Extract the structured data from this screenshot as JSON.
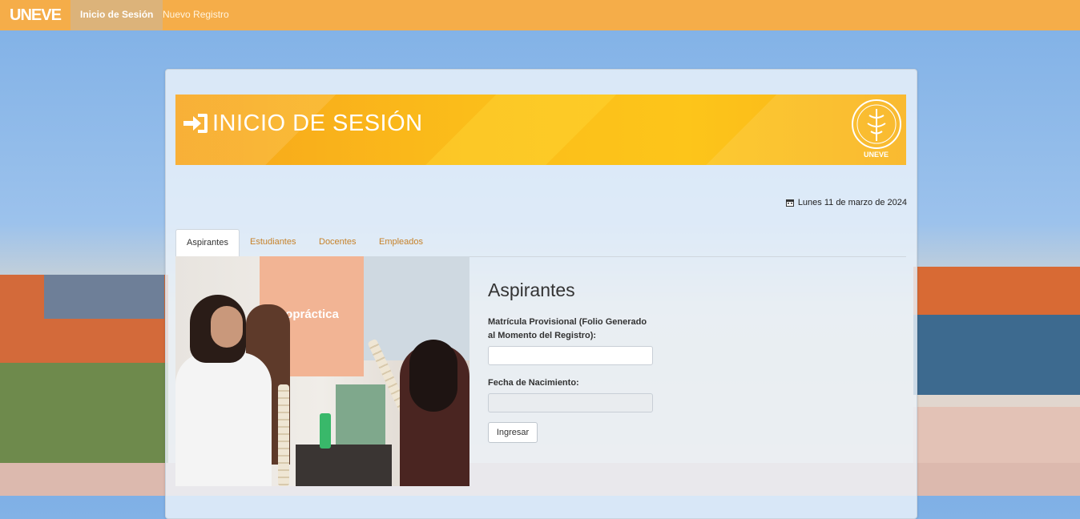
{
  "navbar": {
    "brand": "UNEVE",
    "items": [
      {
        "label": "Inicio de Sesión",
        "active": true
      },
      {
        "label": "Nuevo Registro",
        "active": false
      }
    ],
    "color": "#f5ad49"
  },
  "banner": {
    "title": "INICIO DE SESIÓN",
    "icon": "sign-in-icon",
    "seal_text": "UNEVE",
    "color": "#fbbd1a"
  },
  "date": {
    "icon": "calendar-icon",
    "text": "Lunes 11 de marzo de 2024"
  },
  "tabs": [
    {
      "label": "Aspirantes",
      "active": true
    },
    {
      "label": "Estudiantes",
      "active": false
    },
    {
      "label": "Docentes",
      "active": false
    },
    {
      "label": "Empleados",
      "active": false
    }
  ],
  "photo": {
    "banner_text": "uiropráctica"
  },
  "form": {
    "title": "Aspirantes",
    "matricula_label_1": "Matrícula Provisional (Folio Generado",
    "matricula_label_2": "al Momento del Registro):",
    "matricula_value": "",
    "fecha_label": "Fecha de Nacimiento:",
    "fecha_value": "",
    "submit_label": "Ingresar"
  },
  "accent_link_color": "#c6822a"
}
